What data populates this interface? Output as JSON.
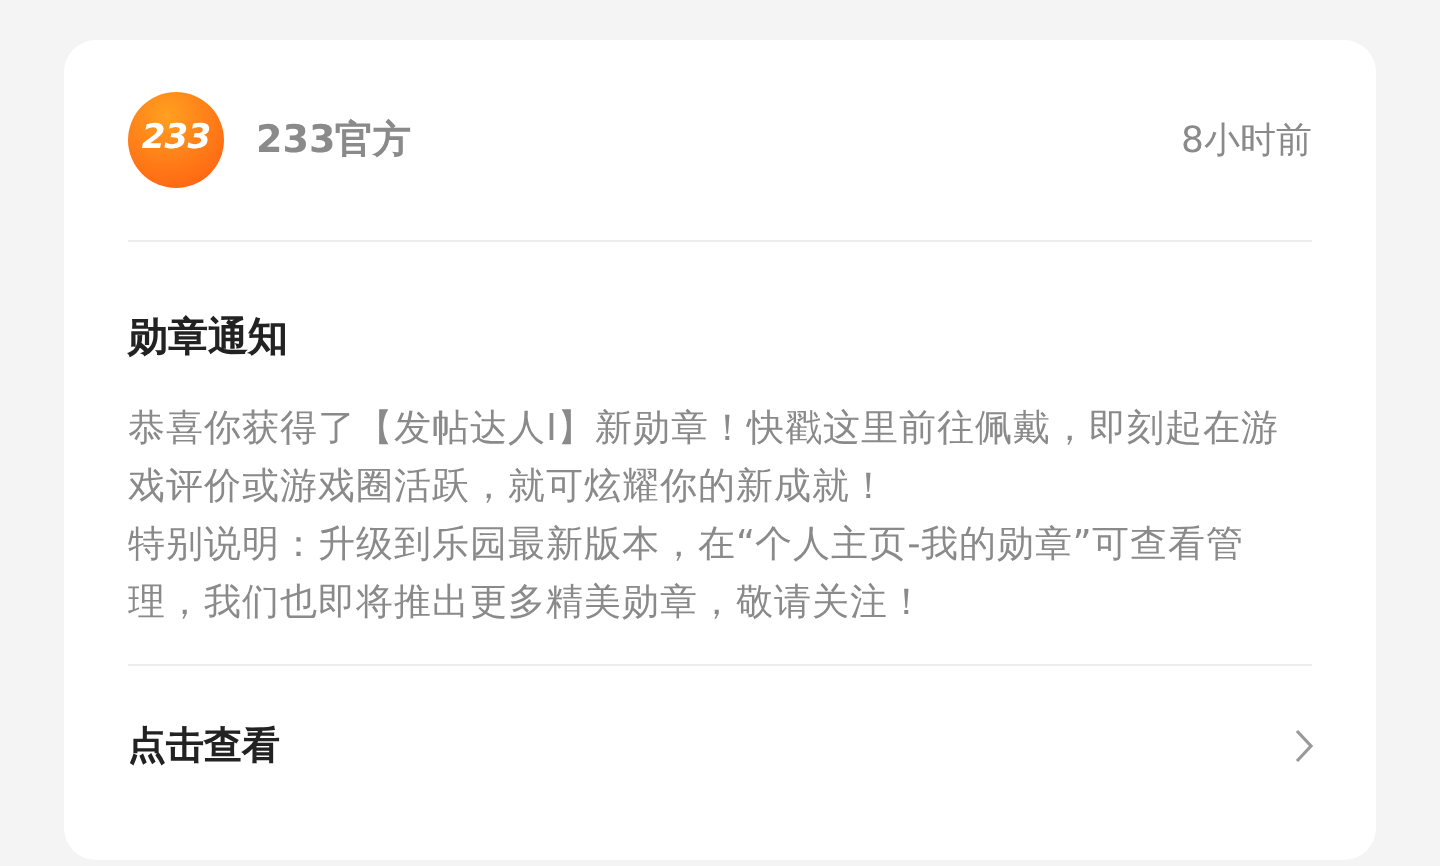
{
  "message": {
    "sender": {
      "logo_text": "233",
      "name": "233官方"
    },
    "time": "8小时前",
    "title": "勋章通知",
    "paragraphs": [
      "恭喜你获得了【发帖达人I】新勋章！快戳这里前往佩戴，即刻起在游戏评价或游戏圈活跃，就可炫耀你的新成就！",
      "特别说明：升级到乐园最新版本，在“个人主页-我的勋章”可查看管理，我们也即将推出更多精美勋章，敬请关注！"
    ],
    "action": "点击查看"
  }
}
